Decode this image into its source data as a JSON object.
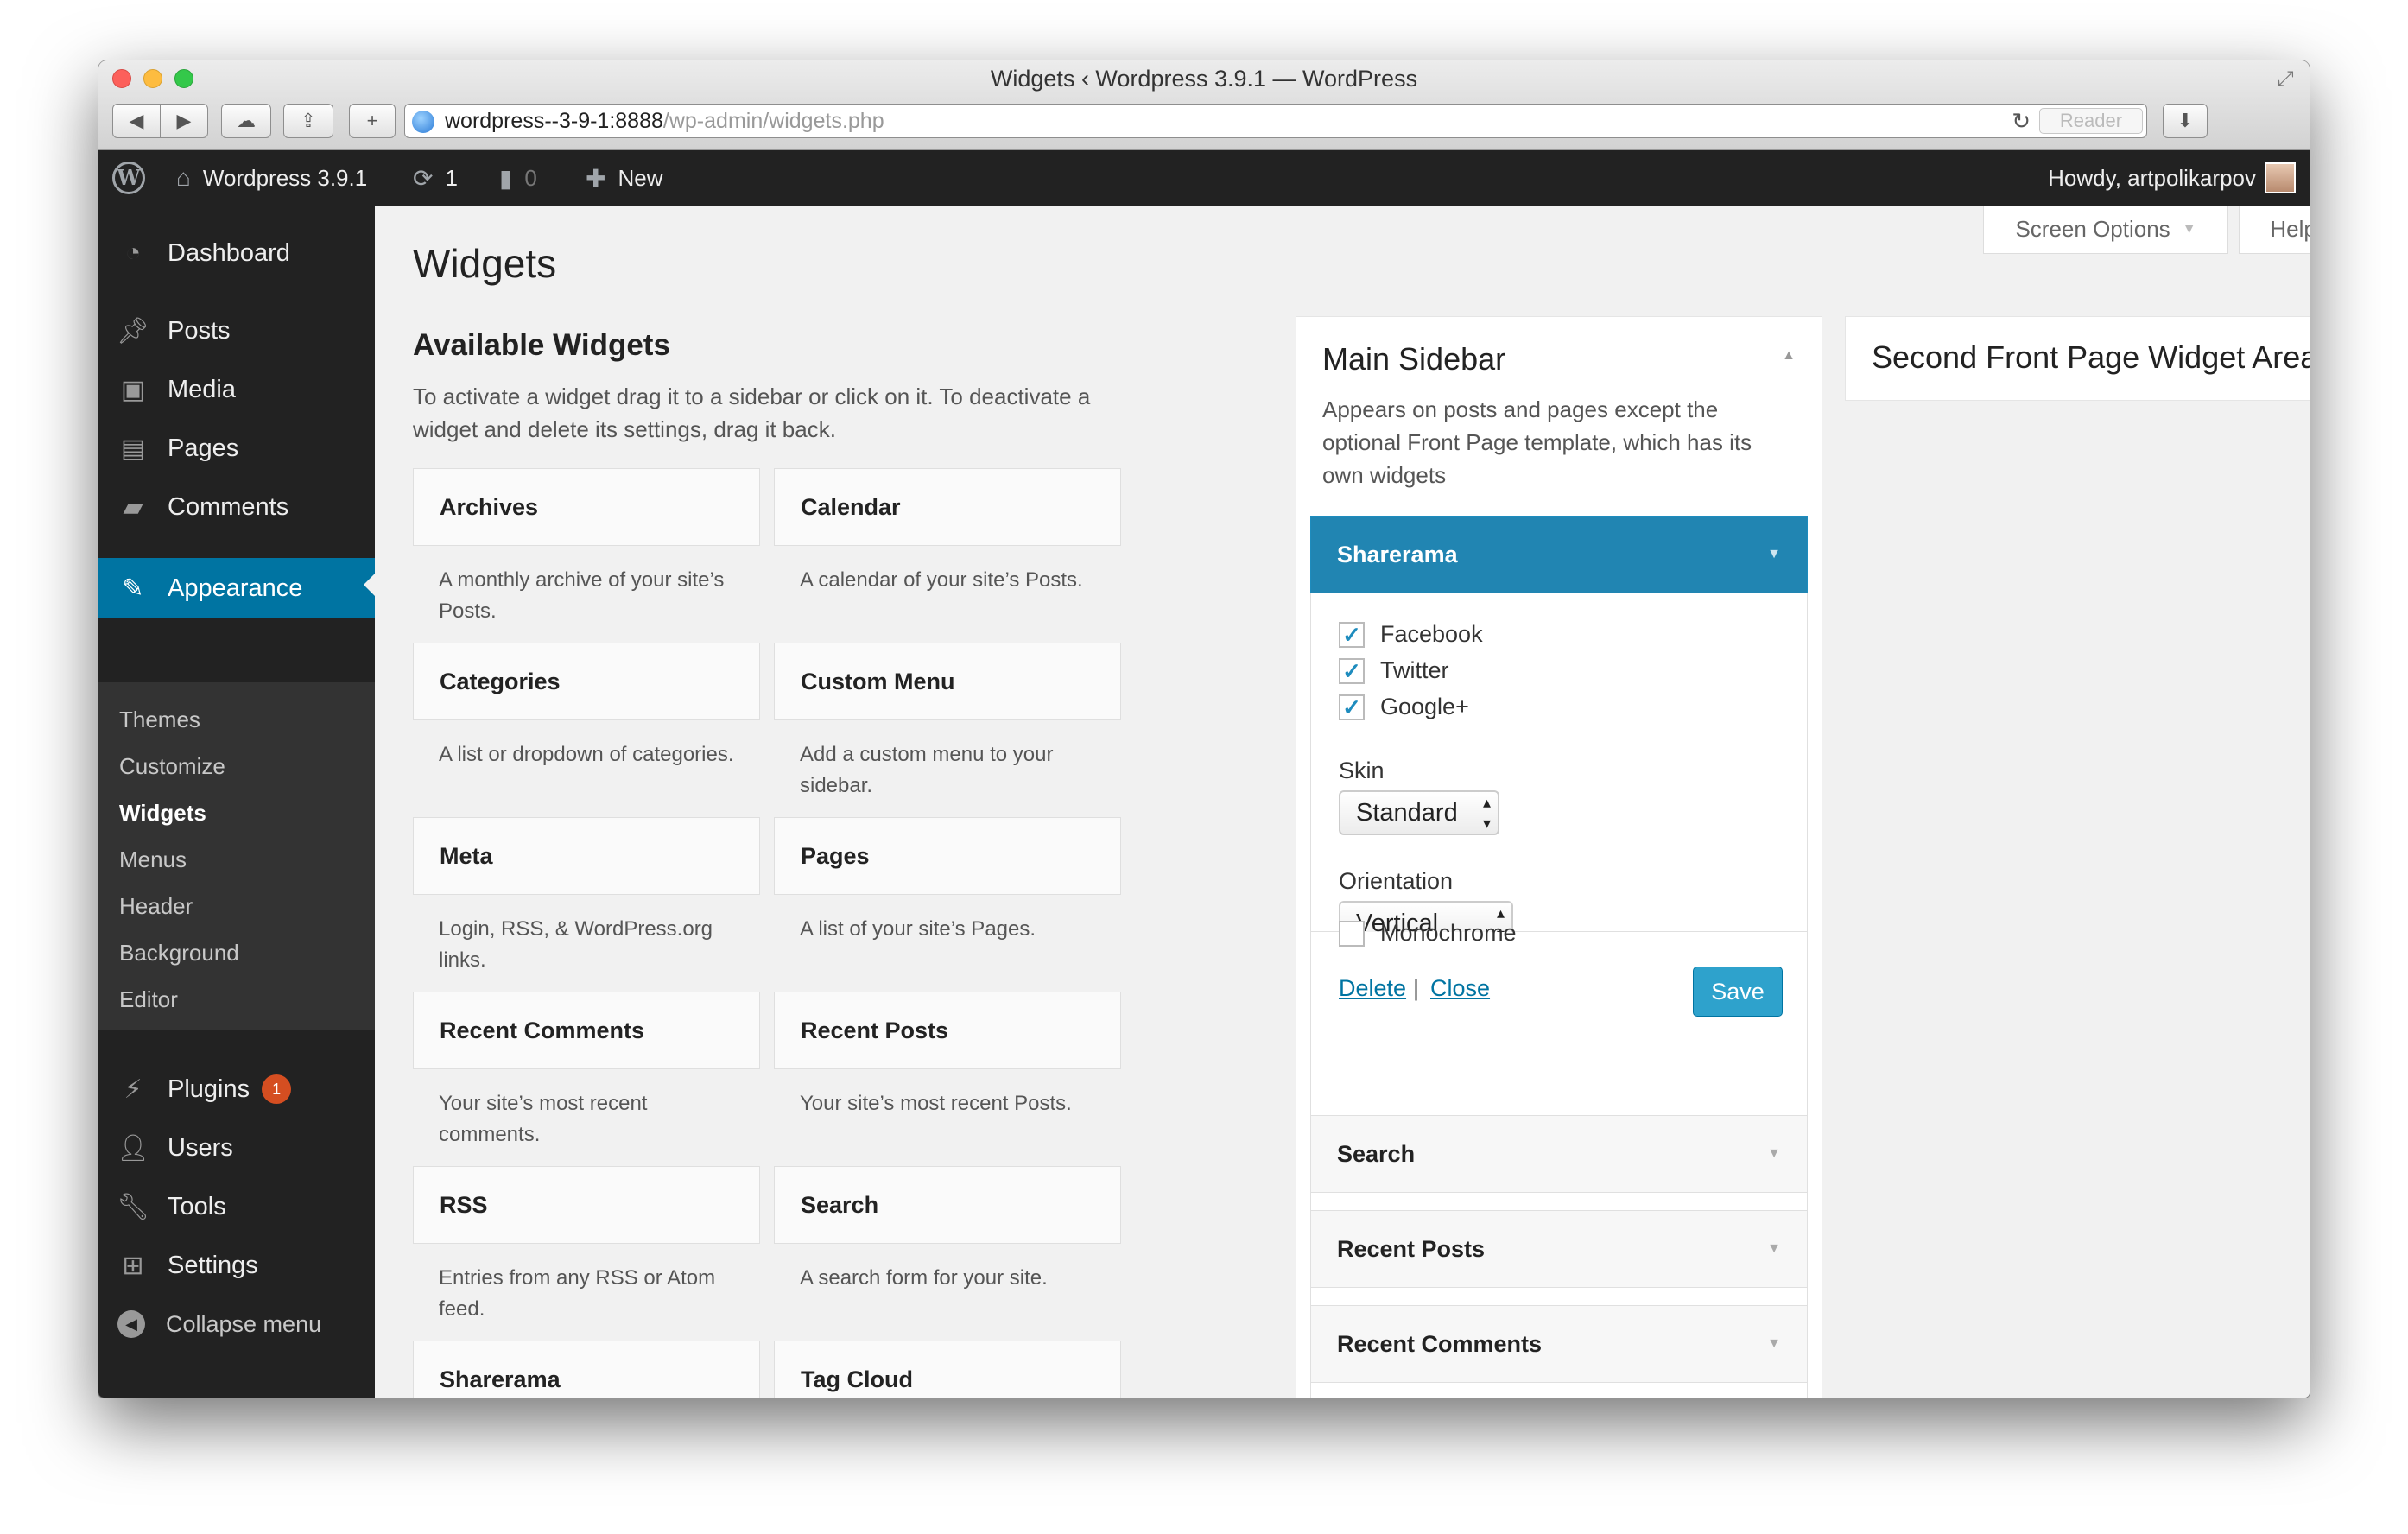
{
  "window": {
    "title": "Widgets ‹ Wordpress 3.9.1 — WordPress",
    "url_host": "wordpress--3-9-1:8888",
    "url_path": "/wp-admin/widgets.php",
    "reader_label": "Reader"
  },
  "adminbar": {
    "site_name": "Wordpress 3.9.1",
    "updates_count": "1",
    "comments_count": "0",
    "new_label": "New",
    "greeting": "Howdy, artpolikarpov"
  },
  "menu": {
    "dashboard": "Dashboard",
    "posts": "Posts",
    "media": "Media",
    "pages": "Pages",
    "comments": "Comments",
    "appearance": "Appearance",
    "appearance_sub": [
      "Themes",
      "Customize",
      "Widgets",
      "Menus",
      "Header",
      "Background",
      "Editor"
    ],
    "plugins": "Plugins",
    "plugins_badge": "1",
    "users": "Users",
    "tools": "Tools",
    "settings": "Settings",
    "collapse": "Collapse menu"
  },
  "screen_tabs": {
    "screen_options": "Screen Options",
    "help": "Help"
  },
  "page": {
    "title": "Widgets",
    "available_title": "Available Widgets",
    "available_desc": "To activate a widget drag it to a sidebar or click on it. To deactivate a widget and delete its settings, drag it back."
  },
  "widgets": [
    {
      "name": "Archives",
      "desc": "A monthly archive of your site’s Posts."
    },
    {
      "name": "Calendar",
      "desc": "A calendar of your site’s Posts."
    },
    {
      "name": "Categories",
      "desc": "A list or dropdown of categories."
    },
    {
      "name": "Custom Menu",
      "desc": "Add a custom menu to your sidebar."
    },
    {
      "name": "Meta",
      "desc": "Login, RSS, & WordPress.org links."
    },
    {
      "name": "Pages",
      "desc": "A list of your site’s Pages."
    },
    {
      "name": "Recent Comments",
      "desc": "Your site’s most recent comments."
    },
    {
      "name": "Recent Posts",
      "desc": "Your site’s most recent Posts."
    },
    {
      "name": "RSS",
      "desc": "Entries from any RSS or Atom feed."
    },
    {
      "name": "Search",
      "desc": "A search form for your site."
    },
    {
      "name": "Sharerama",
      "desc": ""
    },
    {
      "name": "Tag Cloud",
      "desc": ""
    }
  ],
  "main_sidebar": {
    "title": "Main Sidebar",
    "desc": "Appears on posts and pages except the optional Front Page template, which has its own widgets",
    "open_widget": {
      "title": "Sharerama",
      "checkboxes": [
        {
          "label": "Facebook",
          "checked": true
        },
        {
          "label": "Twitter",
          "checked": true
        },
        {
          "label": "Google+",
          "checked": true
        }
      ],
      "skin_label": "Skin",
      "skin_value": "Standard",
      "orientation_label": "Orientation",
      "orientation_value": "Vertical",
      "monochrome_label": "Monochrome",
      "delete_label": "Delete",
      "separator": "|",
      "close_label": "Close",
      "save_label": "Save"
    },
    "widgets": [
      "Search",
      "Recent Posts",
      "Recent Comments"
    ]
  },
  "second_sidebar": {
    "title": "Second Front Page Widget Area"
  },
  "colors": {
    "accent": "#0074a2",
    "admin_bar": "#222222",
    "open_widget": "#2185b2",
    "badge": "#d54e21"
  }
}
